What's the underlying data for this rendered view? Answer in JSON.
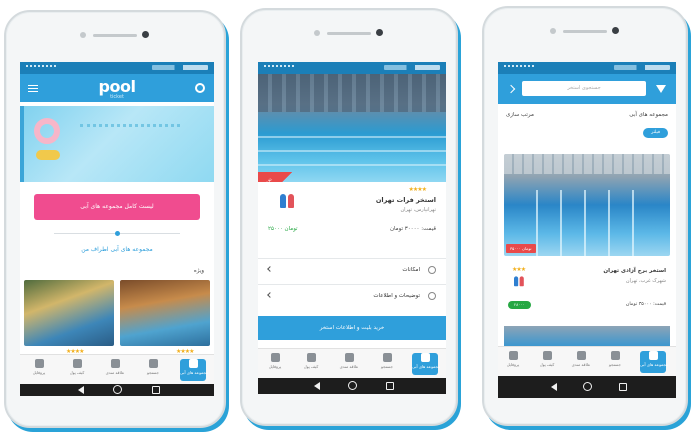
{
  "phone1": {
    "logo_text": "pool",
    "logo_sub": "ticket",
    "pink_button": "لیست کامل مجموعه های آبی",
    "link_text": "مجموعه های آبی اطراف من",
    "section_title": "ویژه",
    "thumb_rating_left": "★★★★",
    "thumb_rating_right": "★★★★",
    "nav": [
      "پروفایل",
      "کیف پول",
      "علاقه مندی",
      "جستجو",
      "مجموعه های آبی"
    ]
  },
  "phone2": {
    "offer_badge": "تخفیف",
    "rating": "★★★★",
    "pool_name": "استخر فرات تهران",
    "pool_loc": "تهرانپارس، تهران",
    "price_label": "قیمت: ۳۰۰۰۰ تومان",
    "price_green": "۲۵۰۰۰ تومان",
    "row1": "امکانات",
    "row2": "توضیحات و اطلاعات",
    "blue_bar": "خرید بلیت و اطلاعات استخر",
    "nav": [
      "پروفایل",
      "کیف پول",
      "علاقه مندی",
      "جستجو",
      "مجموعه های آبی"
    ]
  },
  "phone3": {
    "search_placeholder": "جستجوی استخر",
    "top_left": "مرتب سازی",
    "top_right": "مجموعه های آبی",
    "pill": "فیلتر",
    "price_tag": "۳۵۰۰۰ تومان",
    "rating": "★★★",
    "pool_name": "استخر برج آزادی تهران",
    "pool_loc": "شهرک غرب، تهران",
    "price_label": "قیمت: ۳۵۰۰۰ تومان",
    "green_badge": "۲۸۰۰۰",
    "nav": [
      "پروفایل",
      "کیف پول",
      "علاقه مندی",
      "جستجو",
      "مجموعه های آبی"
    ]
  },
  "colors": {
    "brand_blue": "#2f9fdb",
    "status_blue": "#1b7fb8",
    "pink": "#f04c8f",
    "green": "#27a844",
    "red": "#e94a4a",
    "star": "#f2b01e"
  }
}
